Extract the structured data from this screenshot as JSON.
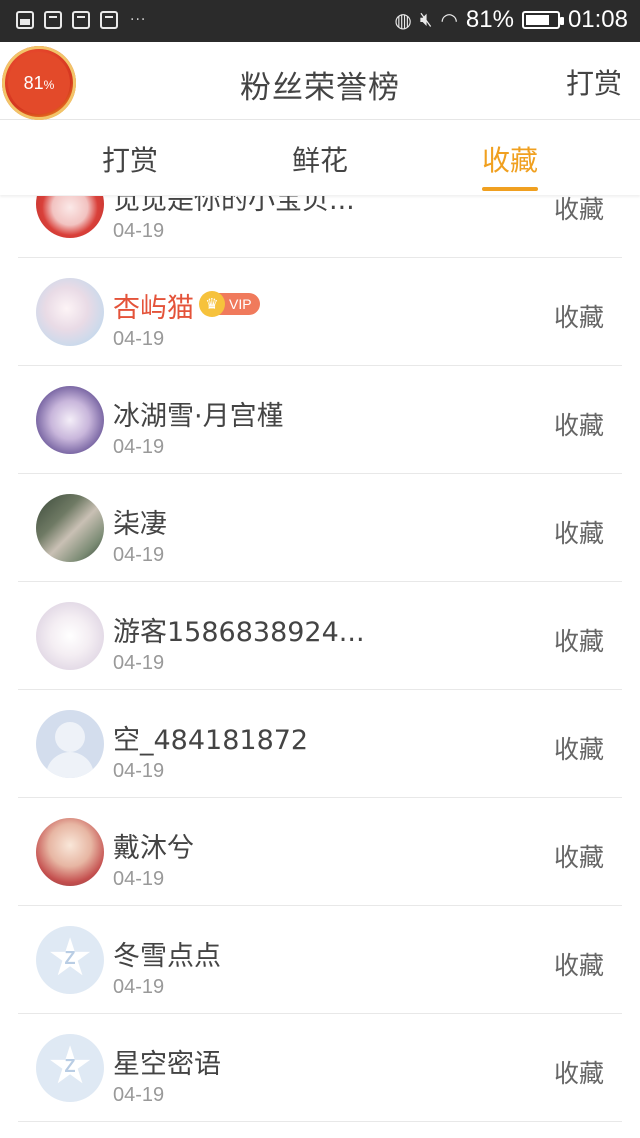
{
  "status_bar": {
    "battery_percent": "81%",
    "battery_level": 0.81,
    "time": "01:08",
    "more_dots": "···",
    "icons": [
      "image-notification-icon",
      "package-icon",
      "package-icon",
      "package-icon",
      "vibrate-icon",
      "mute-icon",
      "wifi-icon",
      "battery-icon"
    ]
  },
  "header": {
    "badge_value": "81",
    "badge_unit": "%",
    "title": "粉丝荣誉榜",
    "action_label": "打赏"
  },
  "tabs": [
    {
      "label": "打赏",
      "active": false
    },
    {
      "label": "鲜花",
      "active": false
    },
    {
      "label": "收藏",
      "active": true
    }
  ],
  "accent_color": "#f0a020",
  "list": [
    {
      "name": "觅觅是你的小宝贝...",
      "date": "04-19",
      "action": "收藏",
      "avatar": "anime-girl-red"
    },
    {
      "name": "杏屿猫",
      "date": "04-19",
      "action": "收藏",
      "avatar": "anime-girl-pastel",
      "vip": true,
      "vip_label": "VIP",
      "vip_icon": "crown-icon"
    },
    {
      "name": "冰湖雪·月宫槿",
      "date": "04-19",
      "action": "收藏",
      "avatar": "anime-girl-purple"
    },
    {
      "name": "柒凄",
      "date": "04-19",
      "action": "收藏",
      "avatar": "photo-green"
    },
    {
      "name": "游客1586838924...",
      "date": "04-19",
      "action": "收藏",
      "avatar": "anime-girl-white"
    },
    {
      "name": "空_484181872",
      "date": "04-19",
      "action": "收藏",
      "avatar": "default-user-icon"
    },
    {
      "name": "戴沐兮",
      "date": "04-19",
      "action": "收藏",
      "avatar": "anime-girl-red-hair"
    },
    {
      "name": "冬雪点点",
      "date": "04-19",
      "action": "收藏",
      "avatar": "qq-star-icon"
    },
    {
      "name": "星空密语",
      "date": "04-19",
      "action": "收藏",
      "avatar": "qq-star-icon"
    }
  ]
}
